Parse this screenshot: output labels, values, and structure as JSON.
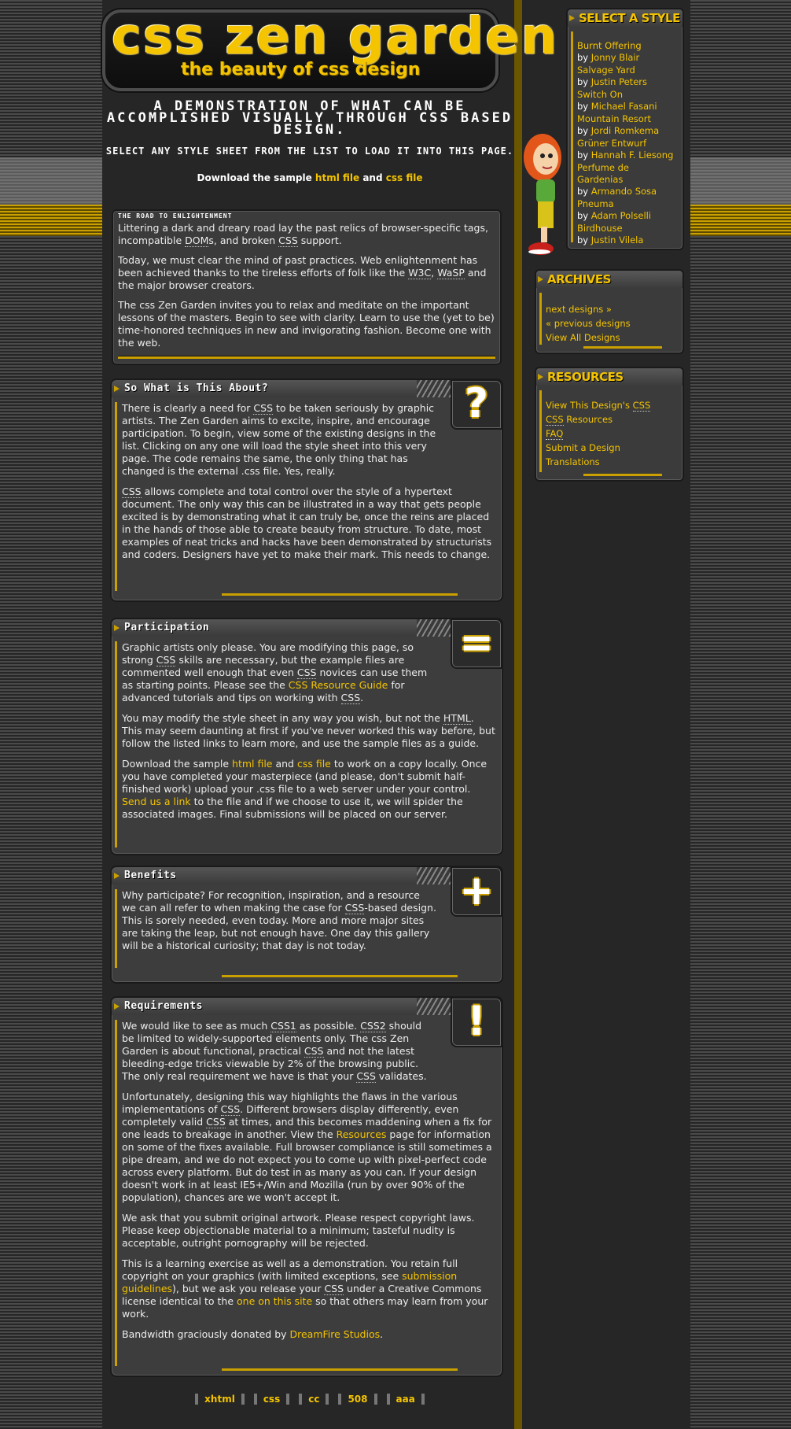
{
  "header": {
    "title": "css zen garden",
    "tagline": "the beauty of css design"
  },
  "summary": {
    "demo": "A demonstration of what can be accomplished visually through CSS based design.",
    "select_line": "Select any style sheet from the list to load it into this page.",
    "download_prefix": "Download the sample ",
    "download_html": "html file",
    "download_and": " and ",
    "download_css": "css file"
  },
  "preamble": {
    "title": "The Road to Enlightenment",
    "p1a": "Littering a dark and dreary road lay the past relics of browser-specific tags, incompatible ",
    "p1_dom": "DOM",
    "p1b": "s, and broken ",
    "p1_css": "CSS",
    "p1c": " support.",
    "p2a": "Today, we must clear the mind of past practices. Web enlightenment has been achieved thanks to the tireless efforts of folk like the ",
    "p2_w3c": "W3C",
    "p2b": ", ",
    "p2_wasp": "WaSP",
    "p2c": " and the major browser creators.",
    "p3": "The css Zen Garden invites you to relax and meditate on the important lessons of the masters. Begin to see with clarity. Learn to use the (yet to be) time-honored techniques in new and invigorating fashion. Become one with the web."
  },
  "explanation": {
    "title": "So What is This About?",
    "icon": "?",
    "p1a": "There is clearly a need for ",
    "p1_css": "CSS",
    "p1b": " to be taken seriously by graphic artists. The Zen Garden aims to excite, inspire, and encourage participation. To begin, view some of the existing designs in the list. Clicking on any one will load the style sheet into this very page. The code remains the same, the only thing that has changed is the external .css file. Yes, really.",
    "p2_css": "CSS",
    "p2": " allows complete and total control over the style of a hypertext document. The only way this can be illustrated in a way that gets people excited is by demonstrating what it can truly be, once the reins are placed in the hands of those able to create beauty from structure. To date, most examples of neat tricks and hacks have been demonstrated by structurists and coders. Designers have yet to make their mark. This needs to change."
  },
  "participation": {
    "title": "Participation",
    "icon": "=",
    "p1a": "Graphic artists only please. You are modifying this page, so strong ",
    "p1_css": "CSS",
    "p1b": " skills are necessary, but the example files are commented well enough that even ",
    "p1_css2": "CSS",
    "p1c": " novices can use them as starting points. Please see the ",
    "p1_link": "CSS Resource Guide",
    "p1d": " for advanced tutorials and tips on working with ",
    "p1_css3": "CSS",
    "p1e": ".",
    "p2a": "You may modify the style sheet in any way you wish, but not the ",
    "p2_html": "HTML",
    "p2b": ". This may seem daunting at first if you've never worked this way before, but follow the listed links to learn more, and use the sample files as a guide.",
    "p3a": "Download the sample ",
    "p3_html": "html file",
    "p3_and": " and ",
    "p3_css": "css file",
    "p3b": " to work on a copy locally. Once you have completed your masterpiece (and please, don't submit half-finished work) upload your .css file to a web server under your control. ",
    "p3_link": "Send us a link",
    "p3c": " to the file and if we choose to use it, we will spider the associated images. Final submissions will be placed on our server."
  },
  "benefits": {
    "title": "Benefits",
    "icon": "+",
    "p1a": "Why participate? For recognition, inspiration, and a resource we can all refer to when making the case for ",
    "p1_css": "CSS",
    "p1b": "-based design. This is sorely needed, even today. More and more major sites are taking the leap, but not enough have. One day this gallery will be a historical curiosity; that day is not today."
  },
  "requirements": {
    "title": "Requirements",
    "icon": "!",
    "p1a": "We would like to see as much ",
    "p1_css1": "CSS1",
    "p1b": " as possible. ",
    "p1_css2": "CSS2",
    "p1c": " should be limited to widely-supported elements only. The css Zen Garden is about functional, practical ",
    "p1_css": "CSS",
    "p1d": " and not the latest bleeding-edge tricks viewable by 2% of the browsing public. The only real requirement we have is that your ",
    "p1_css3": "CSS",
    "p1e": " validates.",
    "p2a": "Unfortunately, designing this way highlights the flaws in the various implementations of ",
    "p2_css": "CSS",
    "p2b": ". Different browsers display differently, even completely valid ",
    "p2_css2": "CSS",
    "p2c": " at times, and this becomes maddening when a fix for one leads to breakage in another. View the ",
    "p2_link": "Resources",
    "p2d": " page for information on some of the fixes available. Full browser compliance is still sometimes a pipe dream, and we do not expect you to come up with pixel-perfect code across every platform. But do test in as many as you can. If your design doesn't work in at least IE5+/Win and Mozilla (run by over 90% of the population), chances are we won't accept it.",
    "p3": "We ask that you submit original artwork. Please respect copyright laws. Please keep objectionable material to a minimum; tasteful nudity is acceptable, outright pornography will be rejected.",
    "p4a": "This is a learning exercise as well as a demonstration. You retain full copyright on your graphics (with limited exceptions, see ",
    "p4_link": "submission guidelines",
    "p4b": "), but we ask you release your ",
    "p4_css": "CSS",
    "p4c": " under a Creative Commons license identical to the ",
    "p4_link2": "one on this site",
    "p4d": " so that others may learn from your work.",
    "p5a": "Bandwidth graciously donated by ",
    "p5_link": "DreamFire Studios",
    "p5b": "."
  },
  "sidebar": {
    "select_title": "Select a Style",
    "by": "by ",
    "designs": [
      {
        "name": "Burnt Offering",
        "author": "Jonny Blair"
      },
      {
        "name": "Salvage Yard",
        "author": "Justin Peters"
      },
      {
        "name": "Switch On",
        "author": "Michael Fasani"
      },
      {
        "name": "Mountain Resort",
        "author": "Jordi Romkema"
      },
      {
        "name": "Grüner Entwurf",
        "author": "Hannah F. Liesong"
      },
      {
        "name": "Perfume de Gardenias",
        "author": "Armando Sosa"
      },
      {
        "name": "Pneuma",
        "author": "Adam Polselli"
      },
      {
        "name": "Birdhouse",
        "author": "Justin Vilela"
      }
    ],
    "archives_title": "Archives",
    "archives": [
      "next designs »",
      "« previous designs",
      "View All Designs"
    ],
    "resources_title": "Resources",
    "res_view_a": "View This Design's ",
    "res_view_css": "CSS",
    "res_css": "CSS",
    "res_css_b": " Resources",
    "res_faq": "FAQ",
    "res_submit": "Submit a Design",
    "res_translations": "Translations"
  },
  "footer": {
    "links": [
      "xhtml",
      "css",
      "cc",
      "508",
      "aaa"
    ]
  },
  "colors": {
    "accent": "#f4c400",
    "background": "#262626",
    "panel": "#3d3d3d"
  }
}
